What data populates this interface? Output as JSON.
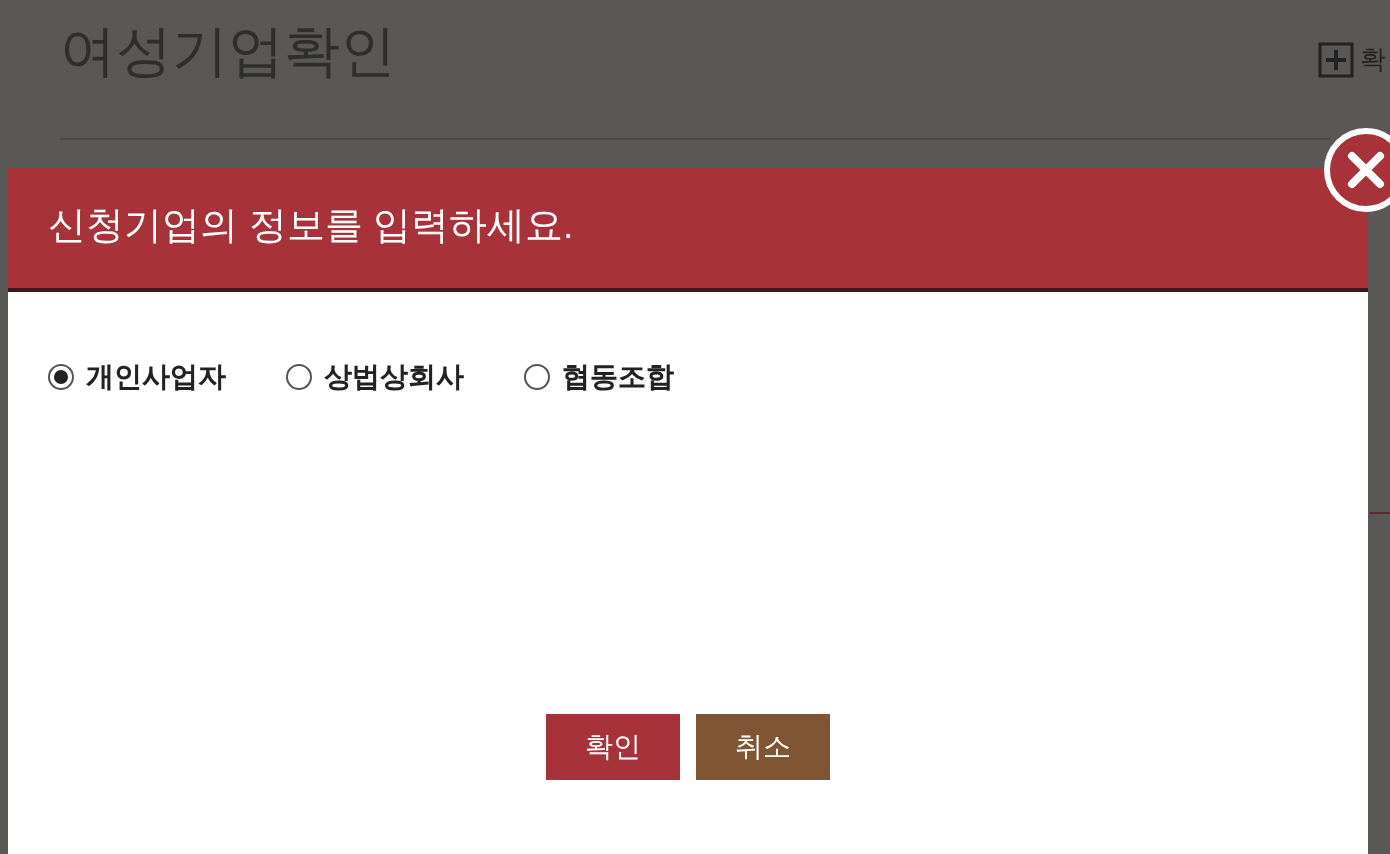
{
  "page": {
    "title": "여성기업확인",
    "zoom_label": "확"
  },
  "dialog": {
    "title": "신청기업의 정보를 입력하세요.",
    "options": [
      {
        "label": "개인사업자",
        "selected": true
      },
      {
        "label": "상법상회사",
        "selected": false
      },
      {
        "label": "협동조합",
        "selected": false
      }
    ],
    "buttons": [
      {
        "label": "확인",
        "kind": "primary"
      },
      {
        "label": "취소",
        "kind": "secondary"
      }
    ]
  }
}
